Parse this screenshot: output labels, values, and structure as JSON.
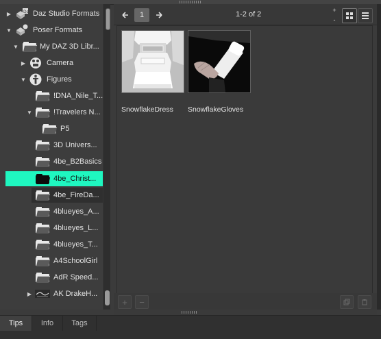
{
  "tree": {
    "items": [
      {
        "label": "Daz Studio Formats",
        "icon": "daz-studio-formats-icon",
        "expanded": false
      },
      {
        "label": "Poser Formats",
        "icon": "poser-formats-icon",
        "expanded": true
      },
      {
        "label": "My DAZ 3D Libr...",
        "icon": "folder-icon",
        "expanded": true
      },
      {
        "label": "Camera",
        "icon": "camera-icon",
        "expanded": false
      },
      {
        "label": "Figures",
        "icon": "figure-icon",
        "expanded": true
      },
      {
        "label": "!DNA_Nile_T...",
        "icon": "folder-icon"
      },
      {
        "label": "!Travelers N...",
        "icon": "folder-icon",
        "expanded": true
      },
      {
        "label": "P5",
        "icon": "folder-icon"
      },
      {
        "label": "3D Univers...",
        "icon": "folder-icon"
      },
      {
        "label": "4be_B2Basics",
        "icon": "folder-icon"
      },
      {
        "label": "4be_Christ...",
        "icon": "folder-icon",
        "selected": true
      },
      {
        "label": "4be_FireDa...",
        "icon": "folder-icon"
      },
      {
        "label": "4blueyes_A...",
        "icon": "folder-icon"
      },
      {
        "label": "4blueyes_L...",
        "icon": "folder-icon"
      },
      {
        "label": "4blueyes_T...",
        "icon": "folder-icon"
      },
      {
        "label": "A4SchoolGirl",
        "icon": "folder-icon"
      },
      {
        "label": "AdR Speed...",
        "icon": "folder-icon"
      },
      {
        "label": "AK DrakeH...",
        "icon": "ak-drake-thumbnail-icon",
        "expanded": false
      }
    ]
  },
  "toolbar": {
    "page": "1",
    "count": "1-2 of 2",
    "size_up": "+",
    "size_down": "-"
  },
  "items": [
    {
      "name": "SnowflakeDress"
    },
    {
      "name": "SnowflakeGloves"
    }
  ],
  "bottom": {
    "add": "+",
    "remove": "−"
  },
  "tabs": [
    {
      "label": "Tips",
      "active": true
    },
    {
      "label": "Info"
    },
    {
      "label": "Tags"
    }
  ],
  "colors": {
    "selection": "#1ff7c0",
    "panel": "#3b3b3b"
  }
}
